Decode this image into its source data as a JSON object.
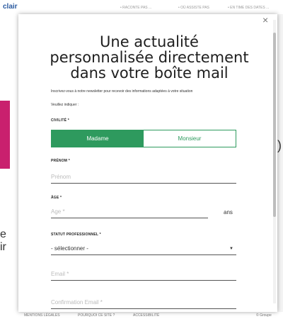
{
  "background": {
    "logo": "clair",
    "nav": [
      "• RACONTE PAS ...",
      "• OÙ ASSISTE PAS",
      "• EN TIME DES DATES ..."
    ],
    "bottom_nav": [
      "MENTIONS LÉGALES",
      "POURQUOI CE SITE ?",
      "ACCESSIBILITÉ",
      "© Groupe"
    ],
    "left_letters": [
      "e",
      "ir"
    ],
    "right_chevron": ")"
  },
  "modal": {
    "close": "×",
    "title": "Une actualité personnalisée directement dans votre boîte mail",
    "intro": "Inscrivez-vous à notre newsletter pour recevoir des informations adaptées à votre situation",
    "instruction": "Veuillez indiquer :",
    "civilite": {
      "label": "CIVILITÉ *",
      "options": [
        "Madame",
        "Monsieur"
      ],
      "selected": "Madame"
    },
    "prenom": {
      "label": "PRÉNOM *",
      "placeholder": "Prénom"
    },
    "age": {
      "label": "ÂGE *",
      "placeholder": "Age *",
      "unit": "ans"
    },
    "statut": {
      "label": "STATUT PROFESSIONNEL *",
      "value": "- sélectionner -"
    },
    "email": {
      "placeholder": "Email *"
    },
    "confirm_email": {
      "placeholder": "Confirmation Email *"
    }
  },
  "colors": {
    "accent": "#2e9a5e",
    "pink": "#c9206e"
  }
}
